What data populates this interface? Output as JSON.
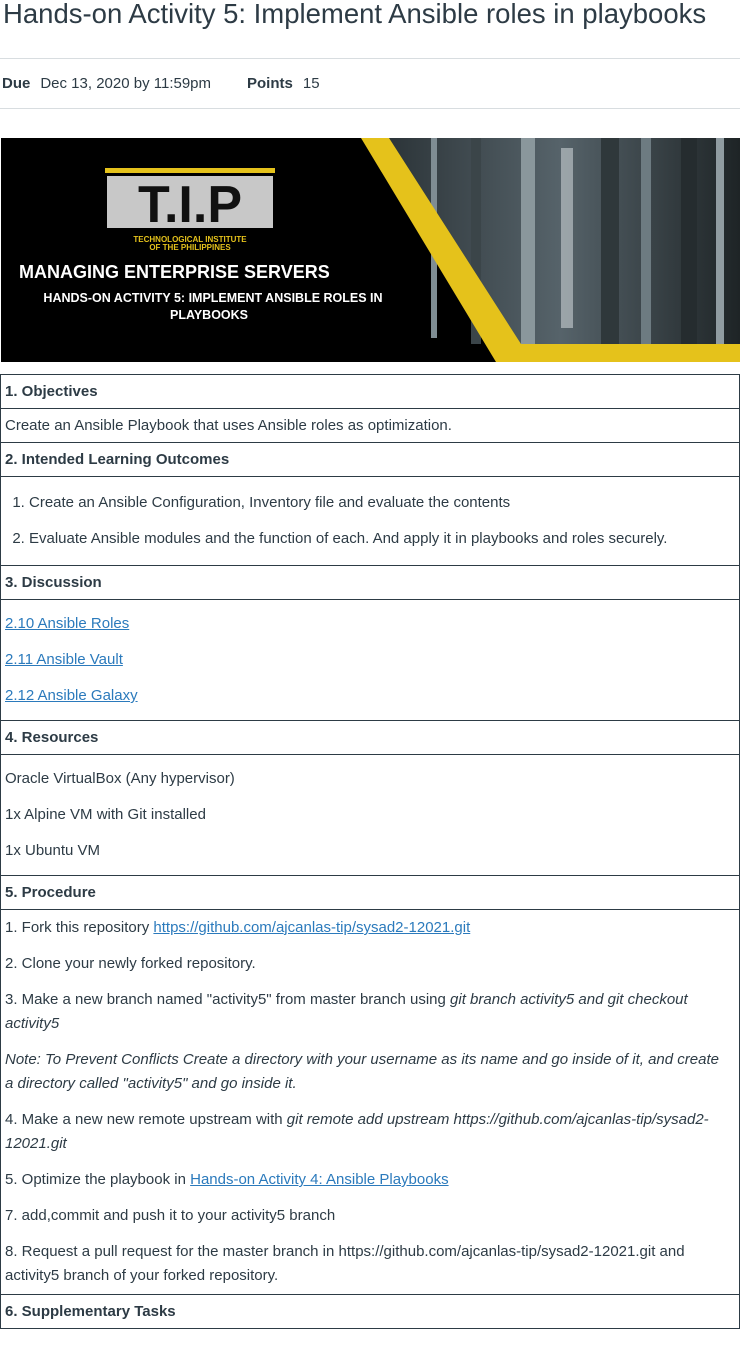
{
  "page": {
    "title": "Hands-on Activity 5: Implement Ansible roles in playbooks",
    "due_label": "Due",
    "due_value": "Dec 13, 2020 by 11:59pm",
    "points_label": "Points",
    "points_value": "15"
  },
  "banner": {
    "logo_text": "T.I.P",
    "institute_line1": "TECHNOLOGICAL INSTITUTE",
    "institute_line2": "OF THE PHILIPPINES",
    "heading": "MANAGING ENTERPRISE SERVERS",
    "sub_line1": "HANDS-ON ACTIVITY 5: IMPLEMENT ANSIBLE ROLES IN",
    "sub_line2": "PLAYBOOKS",
    "accent_color": "#e5c21b"
  },
  "sections": {
    "objectives": {
      "header": "1. Objectives",
      "text": "Create an Ansible Playbook that uses Ansible roles as optimization."
    },
    "ilo": {
      "header": "2. Intended Learning Outcomes",
      "items": [
        "Create an Ansible Configuration, Inventory file and evaluate the contents",
        "Evaluate Ansible modules and the function of each. And apply it in playbooks and roles securely."
      ]
    },
    "discussion": {
      "header": "3. Discussion",
      "links": [
        "2.10 Ansible Roles",
        "2.11 Ansible Vault",
        "2.12 Ansible Galaxy"
      ]
    },
    "resources": {
      "header": "4. Resources",
      "items": [
        "Oracle VirtualBox (Any hypervisor)",
        "1x Alpine VM with Git installed",
        "1x Ubuntu VM"
      ]
    },
    "procedure": {
      "header": "5. Procedure",
      "step1_prefix": "1. Fork this repository ",
      "step1_link": "https://github.com/ajcanlas-tip/sysad2-12021.git",
      "step2": "2. Clone your newly forked repository.",
      "step3_prefix": "3. Make a new branch named \"activity5\" from master branch using ",
      "step3_em": "git branch activity5 and git checkout activity5",
      "note": "Note: To Prevent Conflicts Create a directory with your username as its name and go inside of it, and create a directory called \"activity5\" and go inside it.",
      "step4_prefix": "4. Make a new new remote upstream with ",
      "step4_em": "git remote add upstream https://github.com/ajcanlas-tip/sysad2-12021.git",
      "step5_prefix": "5. Optimize the playbook in ",
      "step5_link": "Hands-on Activity 4: Ansible Playbooks",
      "step7": "7. add,commit and push it to your activity5 branch",
      "step8": "8. Request a pull request for the master branch in https://github.com/ajcanlas-tip/sysad2-12021.git  and activity5 branch of your forked repository."
    },
    "supplementary": {
      "header": "6. Supplementary Tasks"
    }
  }
}
